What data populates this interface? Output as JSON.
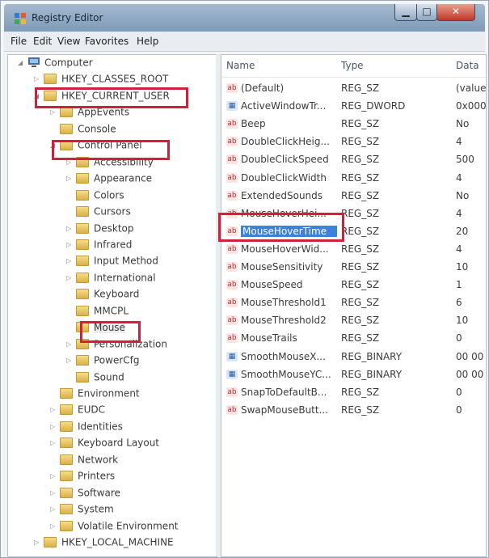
{
  "window": {
    "title": "Registry Editor"
  },
  "colors": {
    "highlight_box": "#d21f3c",
    "selection": "#3d82d8",
    "folder": "#e8c865"
  },
  "menu": [
    "File",
    "Edit",
    "View",
    "Favorites",
    "Help"
  ],
  "tree": [
    {
      "label": "Computer",
      "depth": 0,
      "expander": "◢",
      "icon": "computer-icon"
    },
    {
      "label": "HKEY_CLASSES_ROOT",
      "depth": 1,
      "expander": "▷",
      "icon": "folder-icon"
    },
    {
      "label": "HKEY_CURRENT_USER",
      "depth": 1,
      "expander": "◢",
      "icon": "folder-icon"
    },
    {
      "label": "AppEvents",
      "depth": 2,
      "expander": "▷",
      "icon": "folder-icon"
    },
    {
      "label": "Console",
      "depth": 2,
      "expander": "",
      "icon": "folder-icon"
    },
    {
      "label": "Control Panel",
      "depth": 2,
      "expander": "◢",
      "icon": "folder-icon"
    },
    {
      "label": "Accessibility",
      "depth": 3,
      "expander": "▷",
      "icon": "folder-icon"
    },
    {
      "label": "Appearance",
      "depth": 3,
      "expander": "▷",
      "icon": "folder-icon"
    },
    {
      "label": "Colors",
      "depth": 3,
      "expander": "",
      "icon": "folder-icon"
    },
    {
      "label": "Cursors",
      "depth": 3,
      "expander": "",
      "icon": "folder-icon"
    },
    {
      "label": "Desktop",
      "depth": 3,
      "expander": "▷",
      "icon": "folder-icon"
    },
    {
      "label": "Infrared",
      "depth": 3,
      "expander": "▷",
      "icon": "folder-icon"
    },
    {
      "label": "Input Method",
      "depth": 3,
      "expander": "▷",
      "icon": "folder-icon"
    },
    {
      "label": "International",
      "depth": 3,
      "expander": "▷",
      "icon": "folder-icon"
    },
    {
      "label": "Keyboard",
      "depth": 3,
      "expander": "",
      "icon": "folder-icon"
    },
    {
      "label": "MMCPL",
      "depth": 3,
      "expander": "",
      "icon": "folder-icon"
    },
    {
      "label": "Mouse",
      "depth": 3,
      "expander": "",
      "icon": "folder-icon",
      "selected": true
    },
    {
      "label": "Personalization",
      "depth": 3,
      "expander": "▷",
      "icon": "folder-icon"
    },
    {
      "label": "PowerCfg",
      "depth": 3,
      "expander": "▷",
      "icon": "folder-icon"
    },
    {
      "label": "Sound",
      "depth": 3,
      "expander": "",
      "icon": "folder-icon"
    },
    {
      "label": "Environment",
      "depth": 2,
      "expander": "",
      "icon": "folder-icon"
    },
    {
      "label": "EUDC",
      "depth": 2,
      "expander": "▷",
      "icon": "folder-icon"
    },
    {
      "label": "Identities",
      "depth": 2,
      "expander": "▷",
      "icon": "folder-icon"
    },
    {
      "label": "Keyboard Layout",
      "depth": 2,
      "expander": "▷",
      "icon": "folder-icon"
    },
    {
      "label": "Network",
      "depth": 2,
      "expander": "",
      "icon": "folder-icon"
    },
    {
      "label": "Printers",
      "depth": 2,
      "expander": "▷",
      "icon": "folder-icon"
    },
    {
      "label": "Software",
      "depth": 2,
      "expander": "▷",
      "icon": "folder-icon"
    },
    {
      "label": "System",
      "depth": 2,
      "expander": "▷",
      "icon": "folder-icon"
    },
    {
      "label": "Volatile Environment",
      "depth": 2,
      "expander": "▷",
      "icon": "folder-icon"
    },
    {
      "label": "HKEY_LOCAL_MACHINE",
      "depth": 1,
      "expander": "▷",
      "icon": "folder-icon"
    }
  ],
  "list": {
    "columns": {
      "name": "Name",
      "type": "Type",
      "data": "Data"
    },
    "rows": [
      {
        "name": "(Default)",
        "type": "REG_SZ",
        "data": "(value",
        "icon": "string-value-icon"
      },
      {
        "name": "ActiveWindowTr...",
        "type": "REG_DWORD",
        "data": "0x000",
        "icon": "binary-value-icon"
      },
      {
        "name": "Beep",
        "type": "REG_SZ",
        "data": "No",
        "icon": "string-value-icon"
      },
      {
        "name": "DoubleClickHeig...",
        "type": "REG_SZ",
        "data": "4",
        "icon": "string-value-icon"
      },
      {
        "name": "DoubleClickSpeed",
        "type": "REG_SZ",
        "data": "500",
        "icon": "string-value-icon"
      },
      {
        "name": "DoubleClickWidth",
        "type": "REG_SZ",
        "data": "4",
        "icon": "string-value-icon"
      },
      {
        "name": "ExtendedSounds",
        "type": "REG_SZ",
        "data": "No",
        "icon": "string-value-icon"
      },
      {
        "name": "MouseHoverHei...",
        "type": "REG_SZ",
        "data": "4",
        "icon": "string-value-icon"
      },
      {
        "name": "MouseHoverTime",
        "type": "REG_SZ",
        "data": "20",
        "icon": "string-value-icon",
        "selected": true
      },
      {
        "name": "MouseHoverWid...",
        "type": "REG_SZ",
        "data": "4",
        "icon": "string-value-icon"
      },
      {
        "name": "MouseSensitivity",
        "type": "REG_SZ",
        "data": "10",
        "icon": "string-value-icon"
      },
      {
        "name": "MouseSpeed",
        "type": "REG_SZ",
        "data": "1",
        "icon": "string-value-icon"
      },
      {
        "name": "MouseThreshold1",
        "type": "REG_SZ",
        "data": "6",
        "icon": "string-value-icon"
      },
      {
        "name": "MouseThreshold2",
        "type": "REG_SZ",
        "data": "10",
        "icon": "string-value-icon"
      },
      {
        "name": "MouseTrails",
        "type": "REG_SZ",
        "data": "0",
        "icon": "string-value-icon"
      },
      {
        "name": "SmoothMouseX...",
        "type": "REG_BINARY",
        "data": "00 00",
        "icon": "binary-value-icon"
      },
      {
        "name": "SmoothMouseYC...",
        "type": "REG_BINARY",
        "data": "00 00",
        "icon": "binary-value-icon"
      },
      {
        "name": "SnapToDefaultB...",
        "type": "REG_SZ",
        "data": "0",
        "icon": "string-value-icon"
      },
      {
        "name": "SwapMouseButt...",
        "type": "REG_SZ",
        "data": "0",
        "icon": "string-value-icon"
      }
    ]
  }
}
